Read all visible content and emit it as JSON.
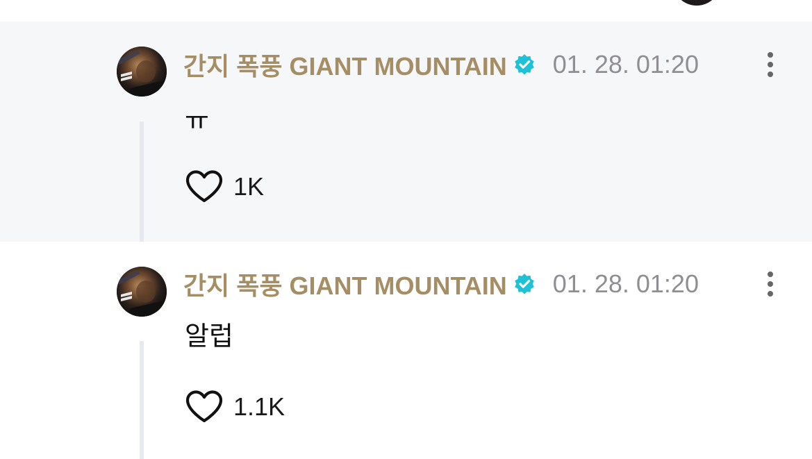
{
  "comments": [
    {
      "author": "간지 폭풍 GIANT MOUNTAIN",
      "timestamp": "01. 28. 01:20",
      "body": "ㅠ",
      "likes": "1K",
      "verified": true,
      "more_icon": "vertical-ellipsis-icon",
      "like_icon": "heart-outline-icon"
    },
    {
      "author": "간지 폭풍 GIANT MOUNTAIN",
      "timestamp": "01. 28. 01:20",
      "body": "알럽",
      "likes": "1.1K",
      "verified": true,
      "more_icon": "vertical-ellipsis-icon",
      "like_icon": "heart-outline-icon"
    }
  ],
  "colors": {
    "author": "#a58d64",
    "verified_badge": "#1fc1d6",
    "timestamp": "#8e8e93",
    "highlight_bg": "#f6f7f9",
    "thread_line": "#e8e9ee"
  }
}
